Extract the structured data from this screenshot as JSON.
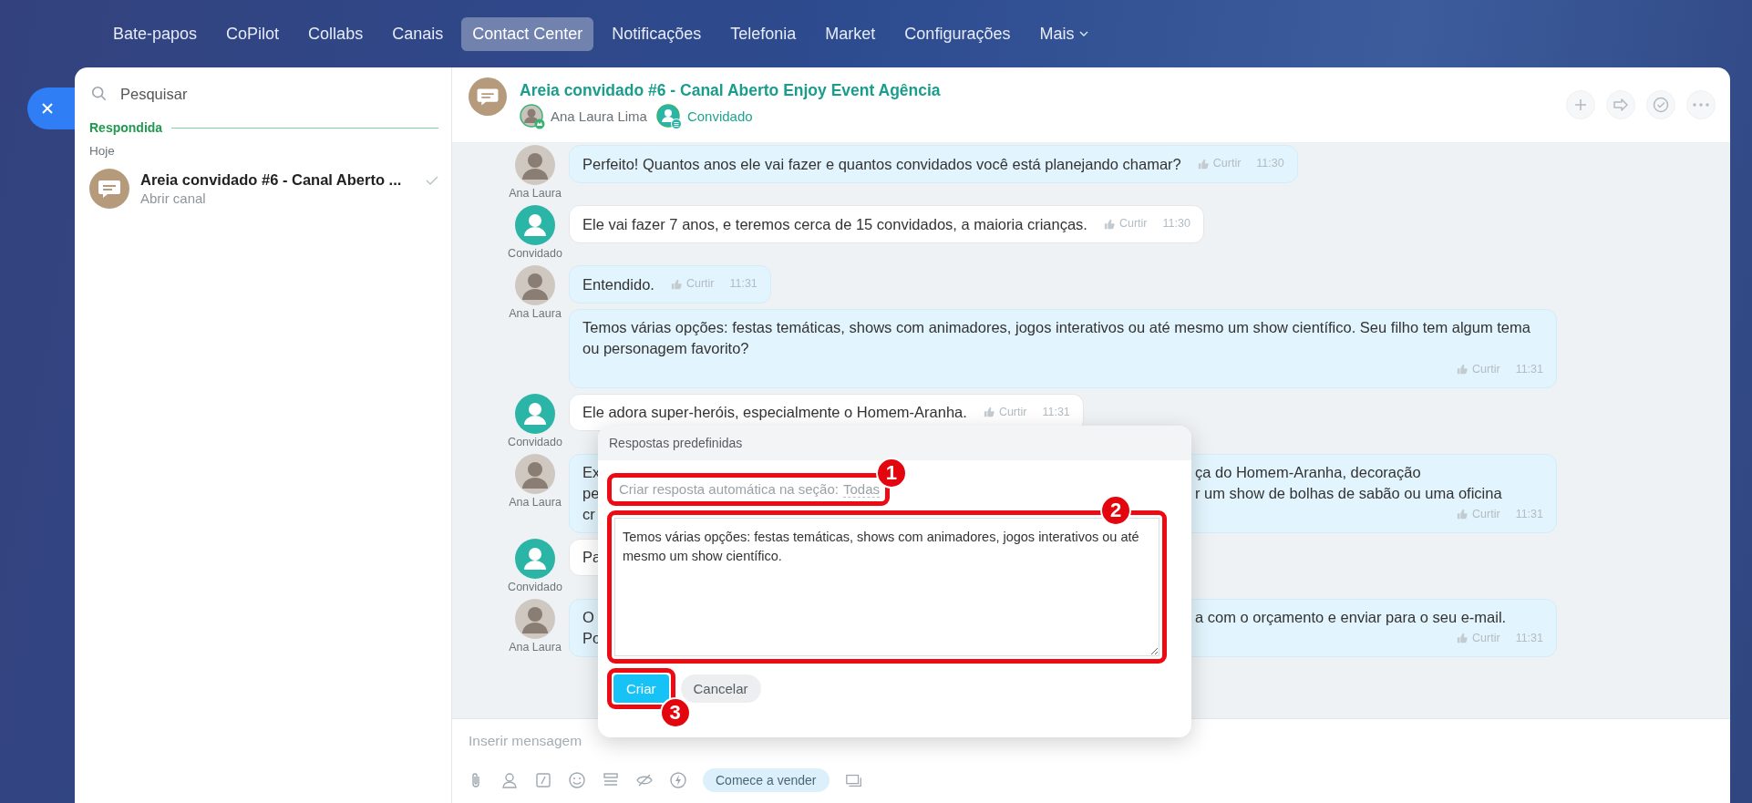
{
  "nav": {
    "items": [
      {
        "label": "Bate-papos",
        "selected": false,
        "kind": "link"
      },
      {
        "label": "CoPilot",
        "selected": false,
        "kind": "link"
      },
      {
        "label": "Collabs",
        "selected": false,
        "kind": "link"
      },
      {
        "label": "Canais",
        "selected": false,
        "kind": "link"
      },
      {
        "label": "Contact Center",
        "selected": true,
        "kind": "link"
      },
      {
        "label": "Notificações",
        "selected": false,
        "kind": "link"
      },
      {
        "label": "Telefonia",
        "selected": false,
        "kind": "link"
      },
      {
        "label": "Market",
        "selected": false,
        "kind": "link"
      },
      {
        "label": "Configurações",
        "selected": false,
        "kind": "link"
      },
      {
        "label": "Mais",
        "selected": false,
        "kind": "menu"
      }
    ]
  },
  "sidebar": {
    "search": {
      "placeholder": "Pesquisar"
    },
    "section": "Respondida",
    "date": "Hoje",
    "chats": [
      {
        "title": "Areia convidado #6 - Canal Aberto ...",
        "subtitle": "Abrir canal",
        "answered": true
      }
    ]
  },
  "chat": {
    "title": "Areia convidado #6 - Canal Aberto Enjoy Event Agência",
    "members": [
      {
        "name": "Ana Laura Lima",
        "kind": "agent"
      },
      {
        "name": "Convidado",
        "kind": "guest"
      }
    ],
    "groups": [
      {
        "sender": "Ana Laura",
        "kind": "agent",
        "messages": [
          {
            "text": "Perfeito! Quantos anos ele vai fazer e quantos convidados você está planejando chamar?",
            "like": "Curtir",
            "time": "11:30"
          }
        ]
      },
      {
        "sender": "Convidado",
        "kind": "guest",
        "messages": [
          {
            "text": "Ele vai fazer 7 anos, e teremos cerca de 15 convidados, a maioria crianças.",
            "like": "Curtir",
            "time": "11:30"
          }
        ]
      },
      {
        "sender": "Ana Laura",
        "kind": "agent",
        "messages": [
          {
            "text": "Entendido.",
            "like": "Curtir",
            "time": "11:31"
          },
          {
            "text": "Temos várias opções: festas temáticas, shows com animadores, jogos interativos ou até mesmo um show científico. Seu filho tem algum tema ou personagem favorito?",
            "like": "Curtir",
            "time": "11:31"
          }
        ]
      },
      {
        "sender": "Convidado",
        "kind": "guest",
        "messages": [
          {
            "text": "Ele adora super-heróis, especialmente o Homem-Aranha.",
            "like": "Curtir",
            "time": "11:31"
          }
        ]
      },
      {
        "sender": "Ana Laura",
        "kind": "agent",
        "messages": [
          {
            "lines": [
              {
                "start": "Ex",
                "end": "ça do Homem-Aranha, decoração"
              },
              {
                "start": "pe",
                "end": "r um show de bolhas de sabão ou uma oficina"
              },
              {
                "start": "cr"
              }
            ],
            "like": "Curtir",
            "time": "11:31"
          }
        ]
      },
      {
        "sender": "Convidado",
        "kind": "guest",
        "messages": [
          {
            "lines": [
              {
                "start": "Pa"
              }
            ]
          }
        ]
      },
      {
        "sender": "Ana Laura",
        "kind": "agent",
        "messages": [
          {
            "lines": [
              {
                "start": "O",
                "end": "a com o orçamento e enviar para o seu e-mail."
              },
              {
                "start": "Po"
              }
            ],
            "like": "Curtir",
            "time": "11:31"
          }
        ]
      }
    ],
    "composer": {
      "placeholder": "Inserir mensagem",
      "sell_button": "Comece a vender"
    }
  },
  "popup": {
    "title": "Respostas predefinidas",
    "section_prompt": "Criar resposta automática na seção:",
    "section_link": "Todas",
    "answer": "Temos várias opções: festas temáticas, shows com animadores, jogos interativos ou até mesmo um show científico.",
    "buttons": [
      {
        "label": "Criar",
        "kind": "primary"
      },
      {
        "label": "Cancelar",
        "kind": "secondary"
      }
    ],
    "callouts": [
      {
        "number": "1"
      },
      {
        "number": "2"
      },
      {
        "number": "3"
      }
    ]
  }
}
